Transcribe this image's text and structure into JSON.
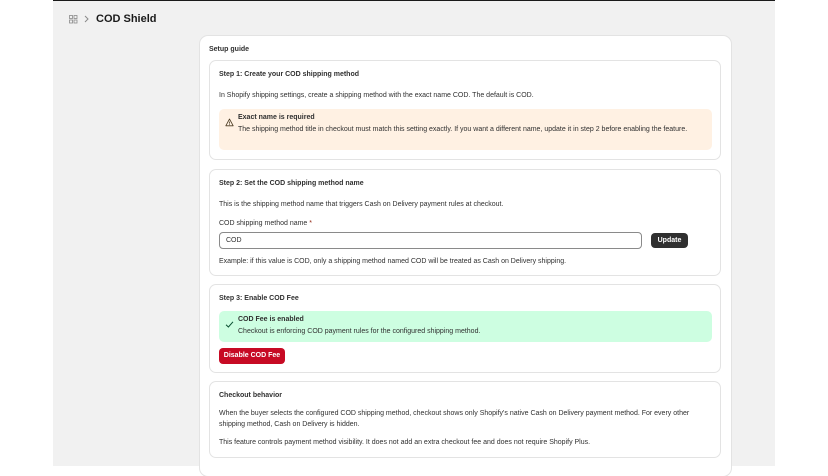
{
  "header": {
    "title": "COD Shield",
    "app_icon": "grid-icon",
    "separator_icon": "chevron-right-icon"
  },
  "guide": {
    "title": "Setup guide"
  },
  "step1": {
    "title": "Step 1: Create your COD shipping method",
    "description": "In Shopify shipping settings, create a shipping method with the exact name COD. The default is COD.",
    "banner_icon": "alert-triangle-icon",
    "banner_title": "Exact name is required",
    "banner_body": "The shipping method title in checkout must match this setting exactly. If you want a different name, update it in step 2 before enabling the feature."
  },
  "step2": {
    "title": "Step 2: Set the COD shipping method name",
    "description": "This is the shipping method name that triggers Cash on Delivery payment rules at checkout.",
    "field_label": "COD shipping method name",
    "required_mark": "*",
    "field_value": "COD",
    "update_label": "Update",
    "help": "Example: if this value is COD, only a shipping method named COD will be treated as Cash on Delivery shipping."
  },
  "step3": {
    "title": "Step 3: Enable COD Fee",
    "banner_icon": "checkmark-icon",
    "banner_title": "COD Fee is enabled",
    "banner_body": "Checkout is enforcing COD payment rules for the configured shipping method.",
    "disable_label": "Disable COD Fee"
  },
  "behavior": {
    "title": "Checkout behavior",
    "p1": "When the buyer selects the configured COD shipping method, checkout shows only Shopify's native Cash on Delivery payment method. For every other shipping method, Cash on Delivery is hidden.",
    "p2": "This feature controls payment method visibility. It does not add an extra checkout fee and does not require Shopify Plus."
  },
  "colors": {
    "warning_bg": "#fff1e3",
    "success_bg": "#cdfee1",
    "danger": "#c70a24",
    "primary": "#303030"
  }
}
